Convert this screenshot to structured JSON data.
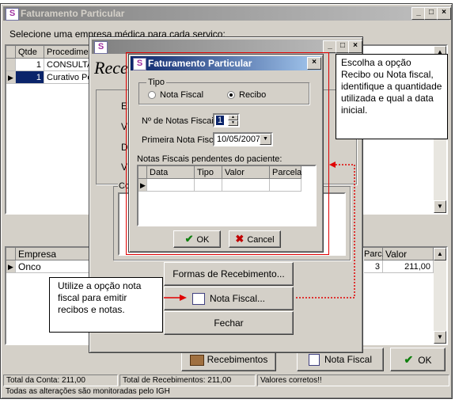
{
  "main_window": {
    "title": "Faturamento Particular",
    "instruction": "Selecione uma empresa médica para cada serviço:",
    "services_table": {
      "headers": [
        "Qtde",
        "Procedimento"
      ],
      "rows": [
        {
          "qty": "1",
          "procedure": "CONSULTA"
        },
        {
          "qty": "1",
          "procedure": "Curativo Pe"
        }
      ]
    },
    "right_edge_text": "ral",
    "companies_table": {
      "headers": [
        "Empresa",
        "Parc.",
        "Valor"
      ],
      "rows": [
        {
          "company": "Onco",
          "installments": "3",
          "value": "211,00"
        }
      ]
    },
    "buttons": {
      "recebimentos": "Recebimentos",
      "nota_fiscal": "Nota Fiscal",
      "ok": "OK"
    },
    "status": {
      "total_conta": "Total da Conta: 211,00",
      "total_recebimentos": "Total de Recebimentos: 211,00",
      "valores": "Valores corretos!!",
      "monitor": "Todas as alterações são monitoradas pelo IGH"
    }
  },
  "receipts_window": {
    "title_partial": "Rece",
    "labels_partial": [
      "E",
      "V",
      "D",
      "V"
    ],
    "group_partial": "Co",
    "buttons": {
      "formas": "Formas de Recebimento...",
      "nota_fiscal": "Nota Fiscal...",
      "fechar": "Fechar"
    }
  },
  "dialog": {
    "title": "Faturamento Particular",
    "tipo_label": "Tipo",
    "radio_nota": "Nota Fiscal",
    "radio_recibo": "Recibo",
    "selected": "Recibo",
    "num_notas_label": "Nº de Notas Fiscais:",
    "num_notas_value": "1",
    "primeira_label": "Primeira Nota Fiscal:",
    "primeira_value": "10/05/2007",
    "pendentes_label": "Notas Fiscais pendentes do paciente:",
    "table_headers": [
      "Data",
      "Tipo",
      "Valor",
      "Parcela"
    ],
    "ok": "OK",
    "cancel": "Cancel"
  },
  "callouts": {
    "top_right": "Escolha a opção Recibo ou Nota fiscal, identifique a quantidade utilizada e qual a data inicial.",
    "bottom_left": "Utilize a opção nota fiscal para emitir recibos e notas."
  },
  "colors": {
    "title_active": "#0a246a",
    "selection": "#0a246a",
    "highlight_border": "#e00000",
    "window_face": "#d4d0c8"
  }
}
